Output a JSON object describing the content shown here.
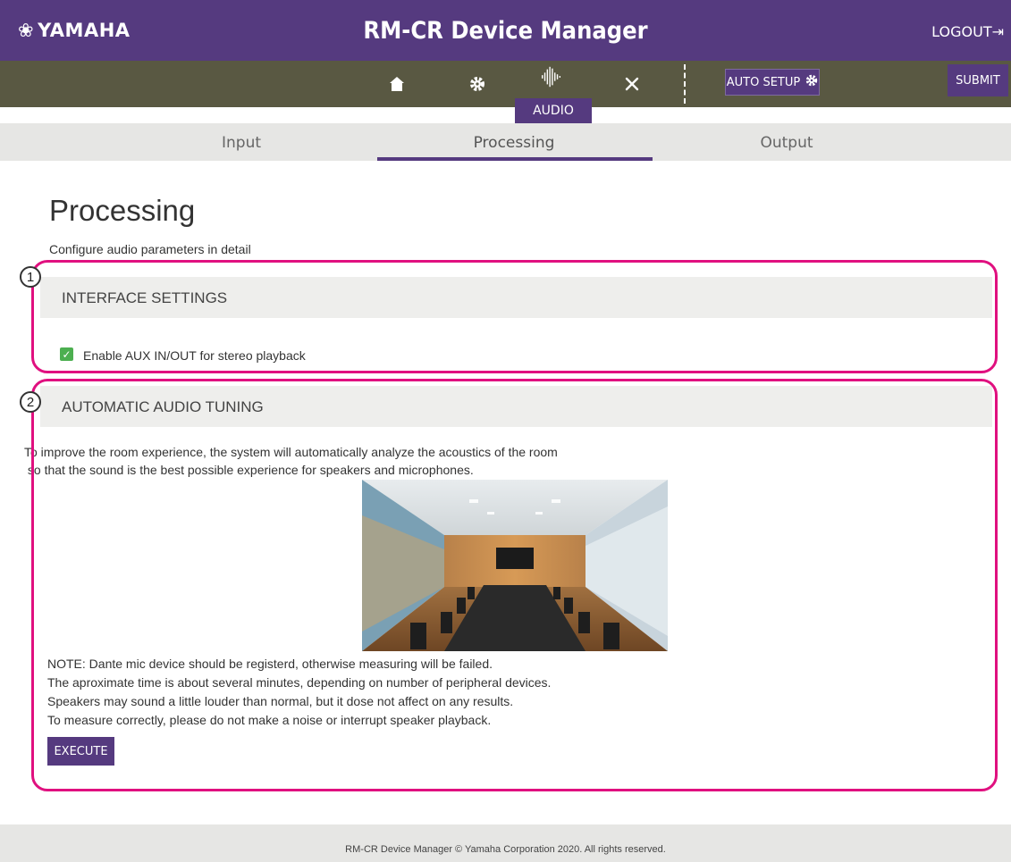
{
  "header": {
    "logo": "YAMAHA",
    "logo_mark": "❀",
    "title": "RM-CR Device Manager",
    "logout": "LOGOUT"
  },
  "toolbar": {
    "icons": [
      "home-icon",
      "gear-icon",
      "audio-waveform-icon",
      "tools-icon"
    ],
    "auto_setup": "AUTO SETUP",
    "submit": "SUBMIT",
    "active_tab": "AUDIO"
  },
  "subtabs": [
    "Input",
    "Processing",
    "Output"
  ],
  "page": {
    "title": "Processing",
    "subtitle": "Configure audio parameters in detail"
  },
  "interface_settings": {
    "marker": "1",
    "heading": "INTERFACE SETTINGS",
    "checkbox_label": "Enable AUX IN/OUT for stereo playback",
    "checked": true
  },
  "auto_tuning": {
    "marker": "2",
    "heading": "AUTOMATIC AUDIO TUNING",
    "intro": [
      "To improve the room experience, the system will automatically analyze the acoustics of the room",
      " so that the sound is the best possible experience for speakers and microphones."
    ],
    "notes": [
      "NOTE: Dante mic device should be registerd, otherwise measuring will be failed.",
      "The aproximate time is about several minutes, depending on number of peripheral devices.",
      "Speakers may sound a little louder than normal, but it dose not affect on any results.",
      "To measure correctly, please do not make a noise or interrupt speaker playback."
    ],
    "execute": "EXECUTE"
  },
  "footer": "RM-CR Device Manager © Yamaha Corporation 2020. All rights reserved.",
  "colors": {
    "brand_purple": "#553a7f",
    "toolbar_olive": "#595842",
    "annotation_magenta": "#e0107f",
    "check_green": "#4caf50"
  }
}
